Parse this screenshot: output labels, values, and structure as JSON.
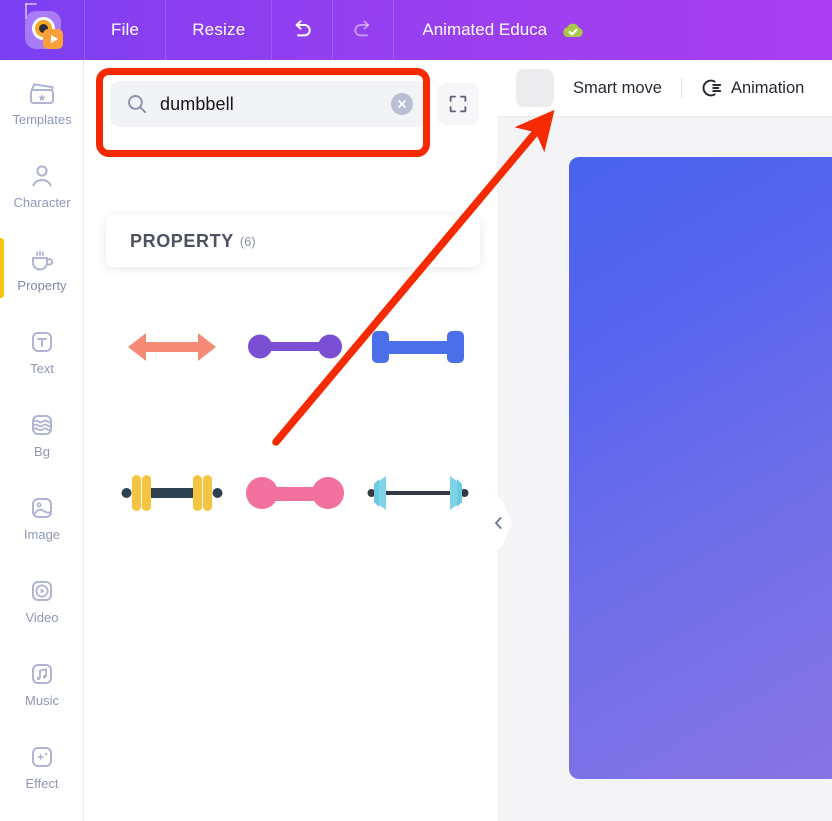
{
  "topbar": {
    "logo_icon": "app-logo-icon",
    "menu": [
      {
        "label": "File",
        "name": "menu-file"
      },
      {
        "label": "Resize",
        "name": "menu-resize"
      }
    ],
    "undo_icon": "undo-icon",
    "redo_icon": "redo-icon",
    "doc_title": "Animated Educa",
    "cloud_icon": "cloud-saved-icon",
    "bg_color": "#8a3ff0"
  },
  "sidebar": {
    "active": "Property",
    "active_indicator_color": "#f5c518",
    "items": [
      {
        "label": "Templates",
        "icon": "clapperboard-icon",
        "name": "sidebar-item-templates"
      },
      {
        "label": "Character",
        "icon": "person-icon",
        "name": "sidebar-item-character"
      },
      {
        "label": "Property",
        "icon": "cup-icon",
        "name": "sidebar-item-property"
      },
      {
        "label": "Text",
        "icon": "text-t-icon",
        "name": "sidebar-item-text"
      },
      {
        "label": "Bg",
        "icon": "layers-waves-icon",
        "name": "sidebar-item-bg"
      },
      {
        "label": "Image",
        "icon": "picture-icon",
        "name": "sidebar-item-image"
      },
      {
        "label": "Video",
        "icon": "play-circle-icon",
        "name": "sidebar-item-video"
      },
      {
        "label": "Music",
        "icon": "music-note-icon",
        "name": "sidebar-item-music"
      },
      {
        "label": "Effect",
        "icon": "sparkle-icon",
        "name": "sidebar-item-effect"
      }
    ]
  },
  "search": {
    "icon": "search-icon",
    "value": "dumbbell",
    "placeholder": "Search",
    "clear_icon": "clear-circle-icon",
    "expand_icon": "fullscreen-icon"
  },
  "section": {
    "title": "PROPERTY",
    "count": "(6)"
  },
  "results": [
    {
      "name": "result-item-salmon-arrow",
      "icon": "double-arrow-icon",
      "color": "#f58b77"
    },
    {
      "name": "result-item-purple-dumbbell",
      "icon": "dumbbell-icon",
      "color": "#7b4fd4"
    },
    {
      "name": "result-item-blue-dumbbell",
      "icon": "dumbbell-icon",
      "color": "#4a6fe8"
    },
    {
      "name": "result-item-yellow-dumbbell",
      "icon": "dumbbell-icon",
      "color": "#f5c542"
    },
    {
      "name": "result-item-pink-dumbbell",
      "icon": "dumbbell-icon",
      "color": "#f2719f"
    },
    {
      "name": "result-item-cyan-barbell",
      "icon": "barbell-icon",
      "color": "#7fd4e8"
    }
  ],
  "stage": {
    "swatch_color": "#ececef",
    "smart_move_label": "Smart move",
    "animation_icon": "animation-icon",
    "animation_label": "Animation",
    "canvas_gradient_start": "#4a63ee",
    "canvas_gradient_end": "#8a73e2",
    "collapse_icon": "chevron-left-icon"
  },
  "annotations": {
    "highlight_color": "#f62a00",
    "arrow_color": "#f62a00"
  }
}
